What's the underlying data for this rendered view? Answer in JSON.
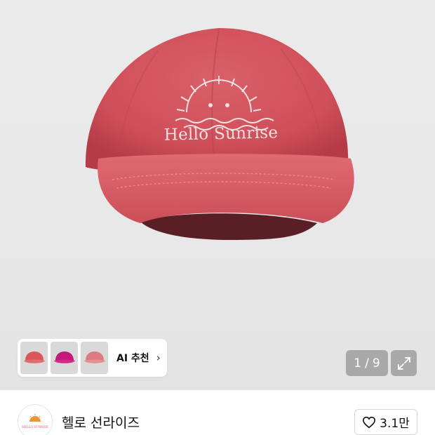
{
  "product": {
    "embroidery_text": "Hello Sunrise"
  },
  "ai_recommend": {
    "thumbnails": [
      {
        "icon": "red-cap-thumbnail",
        "color": "#d9575a"
      },
      {
        "icon": "magenta-cap-thumbnail",
        "color": "#c2197a"
      },
      {
        "icon": "pink-cap-thumbnail",
        "color": "#d97b80"
      }
    ],
    "label": "AI 추천",
    "chevron": "›"
  },
  "pager": {
    "current": "1",
    "separator": "/",
    "total": "9"
  },
  "brand": {
    "name": "헬로 선라이즈",
    "logo_text": "HELLO SUNRISE"
  },
  "like": {
    "count": "3.1만"
  },
  "colors": {
    "cap": "#d6535b",
    "cap_shadow": "#b83c45",
    "background": "#e9e9e9"
  }
}
